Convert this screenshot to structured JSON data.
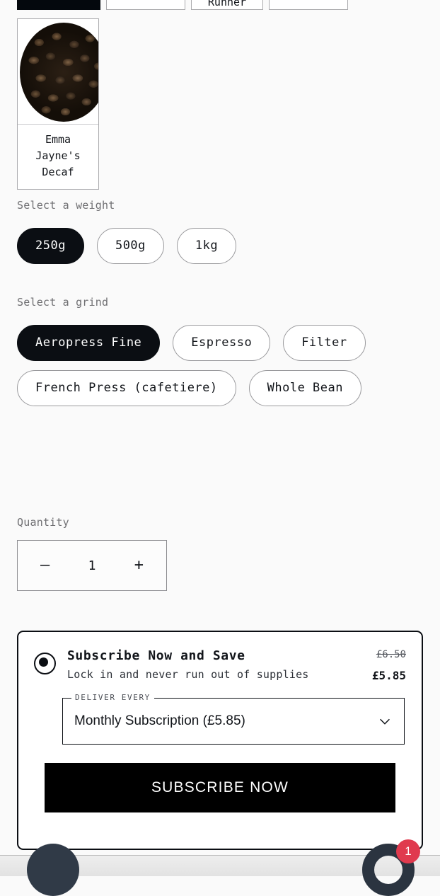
{
  "page": {
    "background_color": "#fafafa",
    "accent_color": "#0b0e13",
    "badge_color": "#e03a4e",
    "fab_color": "#2b3440"
  },
  "variant_strip": {
    "items": [
      {
        "label": "",
        "selected": true
      },
      {
        "label": "",
        "selected": false
      },
      {
        "label": "Runner",
        "selected": false
      },
      {
        "label": "",
        "selected": false
      }
    ]
  },
  "product_card": {
    "image_alt": "coffee-beans-image",
    "name": "Emma Jayne's Decaf"
  },
  "weight": {
    "label": "Select a weight",
    "options": [
      {
        "label": "250g",
        "selected": true
      },
      {
        "label": "500g",
        "selected": false
      },
      {
        "label": "1kg",
        "selected": false
      }
    ]
  },
  "grind": {
    "label": "Select a grind",
    "options": [
      {
        "label": "Aeropress Fine",
        "selected": true
      },
      {
        "label": "Espresso",
        "selected": false
      },
      {
        "label": "Filter",
        "selected": false
      },
      {
        "label": "French Press (cafetiere)",
        "selected": false
      },
      {
        "label": "Whole Bean",
        "selected": false
      }
    ]
  },
  "quantity": {
    "label": "Quantity",
    "decrease_label": "—",
    "value": "1",
    "increase_label": "+"
  },
  "subscription": {
    "selected": true,
    "title": "Subscribe Now and Save",
    "subtitle": "Lock in and never run out of supplies",
    "price_original": "£6.50",
    "price_discounted": "£5.85",
    "deliver_every_label": "DELIVER EVERY",
    "frequency_selected": "Monthly Subscription (£5.85)",
    "frequency_options": [
      "Monthly Subscription (£5.85)"
    ],
    "cta_label": "SUBSCRIBE NOW"
  },
  "bottom_bar": {
    "left_button": "chat-bubble-button",
    "right_button": "cart-button",
    "cart_count": "1"
  }
}
